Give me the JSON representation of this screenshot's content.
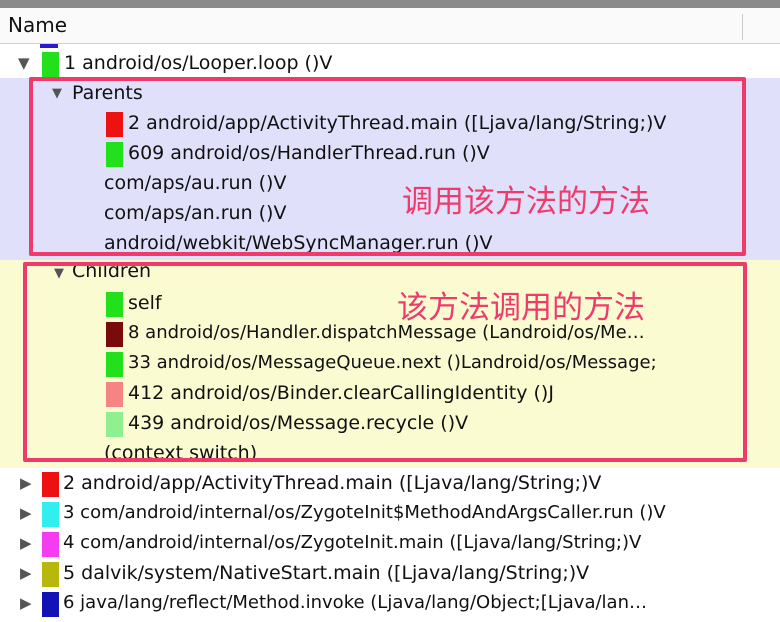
{
  "header": {
    "column_name": "Name"
  },
  "root": {
    "label": "1 android/os/Looper.loop ()V",
    "color": "#22e01c",
    "icon": "triangle-down-icon"
  },
  "parents": {
    "label": "Parents",
    "items": [
      {
        "label": "2 android/app/ActivityThread.main ([Ljava/lang/String;)V",
        "color": "#ee1111"
      },
      {
        "label": "609 android/os/HandlerThread.run ()V",
        "color": "#22e01c"
      },
      {
        "label": "com/aps/au.run ()V"
      },
      {
        "label": "com/aps/an.run ()V"
      },
      {
        "label": "android/webkit/WebSyncManager.run ()V"
      }
    ]
  },
  "children": {
    "label": "Children",
    "items": [
      {
        "label": "self",
        "color": "#22e01c"
      },
      {
        "label": "8 android/os/Handler.dispatchMessage (Landroid/os/Me…",
        "color": "#7a0b0b"
      },
      {
        "label": "33 android/os/MessageQueue.next ()Landroid/os/Message;",
        "color": "#22e01c"
      },
      {
        "label": "412 android/os/Binder.clearCallingIdentity ()J",
        "color": "#f58585"
      },
      {
        "label": "439 android/os/Message.recycle ()V",
        "color": "#90f090"
      },
      {
        "label": "(context switch)"
      }
    ]
  },
  "annotations": {
    "parents_note": "调用该方法的方法",
    "children_note": "该方法调用的方法"
  },
  "siblings": [
    {
      "label": "2 android/app/ActivityThread.main ([Ljava/lang/String;)V",
      "color": "#ee1111"
    },
    {
      "label": "3 com/android/internal/os/ZygoteInit$MethodAndArgsCaller.run ()V",
      "color": "#33eeee"
    },
    {
      "label": "4 com/android/internal/os/ZygoteInit.main ([Ljava/lang/String;)V",
      "color": "#f53cf0"
    },
    {
      "label": "5 dalvik/system/NativeStart.main ([Ljava/lang/String;)V",
      "color": "#b8b80c"
    },
    {
      "label": "6 java/lang/reflect/Method.invoke (Ljava/lang/Object;[Ljava/lan…",
      "color": "#1212b5"
    }
  ]
}
